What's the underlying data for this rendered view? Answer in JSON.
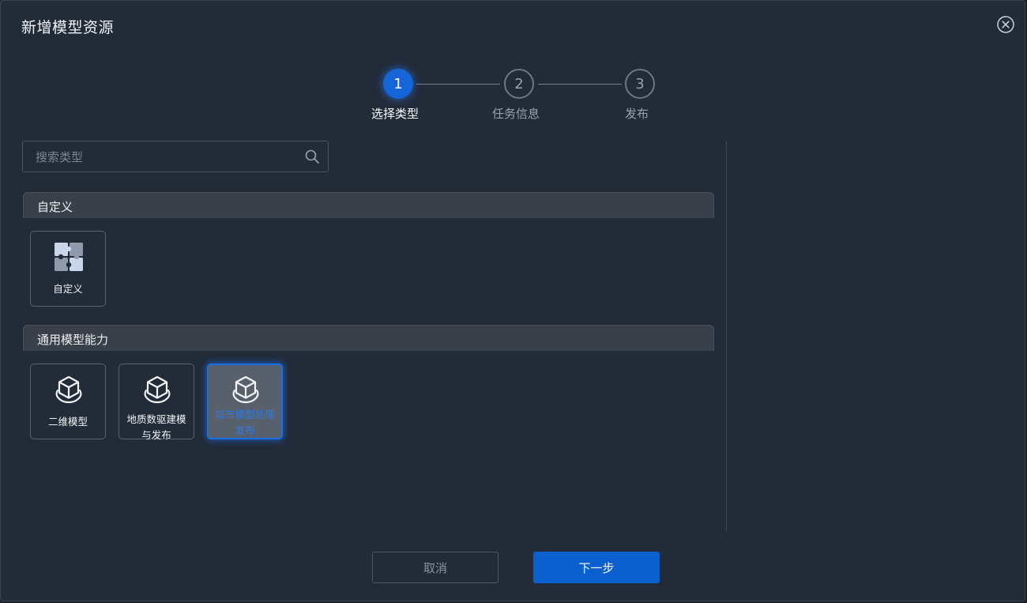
{
  "dialog": {
    "title": "新增模型资源"
  },
  "steps": [
    {
      "number": "1",
      "label": "选择类型",
      "state": "active"
    },
    {
      "number": "2",
      "label": "任务信息",
      "state": "idle"
    },
    {
      "number": "3",
      "label": "发布",
      "state": "idle"
    }
  ],
  "search": {
    "placeholder": "搜索类型",
    "value": ""
  },
  "sections": [
    {
      "title": "自定义",
      "cards": [
        {
          "label": "自定义",
          "icon": "puzzle-icon"
        }
      ]
    },
    {
      "title": "通用模型能力",
      "cards": [
        {
          "label": "二维模型",
          "icon": "cube-icon"
        },
        {
          "label_line1": "地质数驱建模",
          "label_line2": "与发布",
          "icon": "cube-icon"
        },
        {
          "label_line1": "城市模型处理",
          "label_line2": "发布",
          "icon": "cube-icon",
          "selected": true
        }
      ]
    }
  ],
  "footer": {
    "cancel_label": "取消",
    "next_label": "下一步"
  },
  "colors": {
    "accent": "#1565d8",
    "background": "#222b38",
    "section_header": "#3a4049"
  }
}
